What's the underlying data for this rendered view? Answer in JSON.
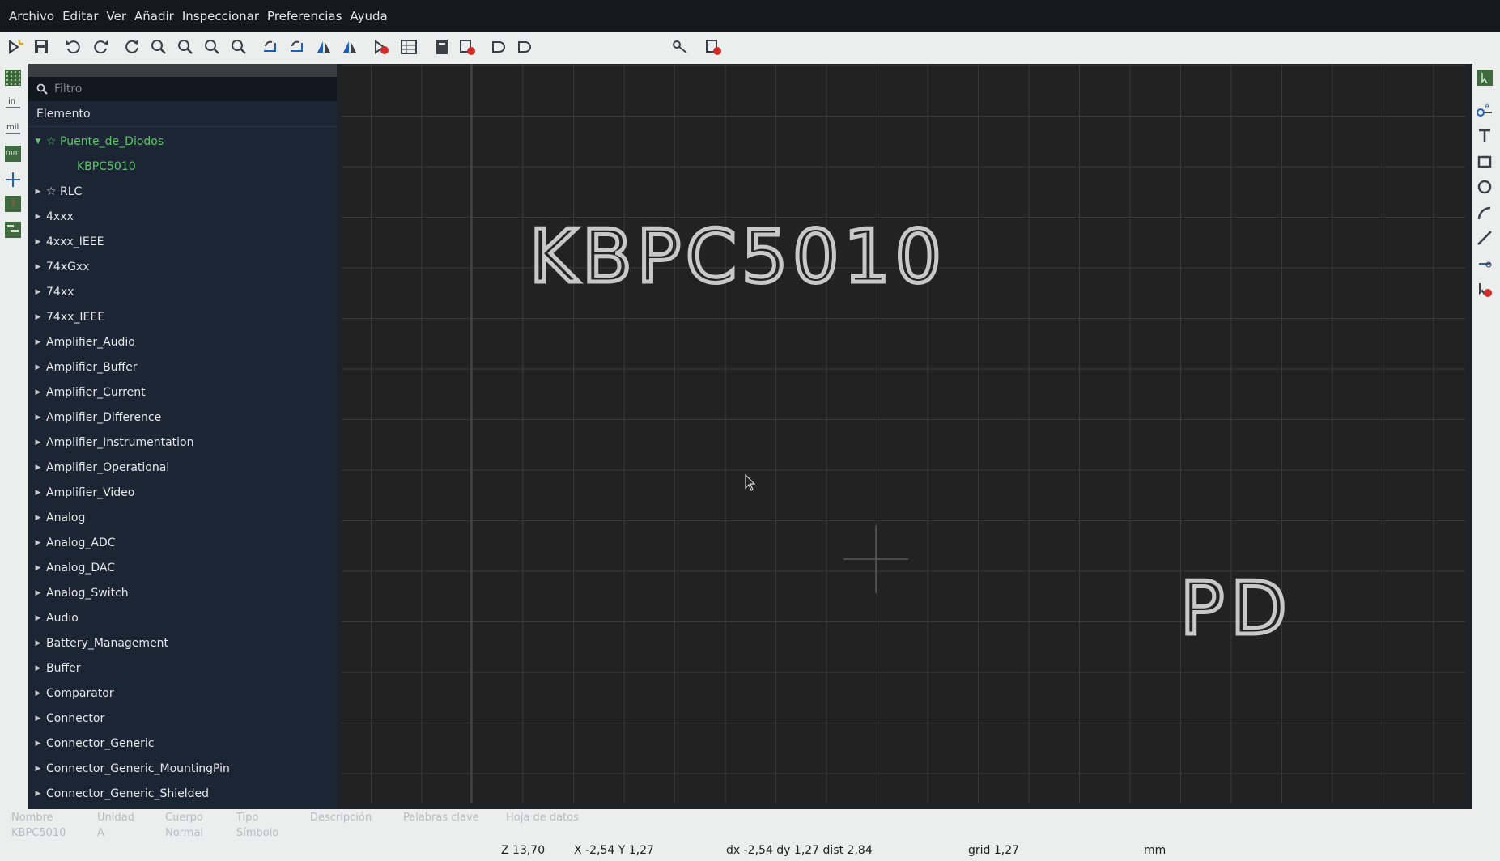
{
  "menu": [
    "Archivo",
    "Editar",
    "Ver",
    "Añadir",
    "Inspeccionar",
    "Preferencias",
    "Ayuda"
  ],
  "toolbar_icons": [
    "new-symbol-icon",
    "save-icon",
    "undo-icon",
    "redo-icon",
    "refresh-icon",
    "zoom-in-icon",
    "zoom-out-icon",
    "zoom-fit-icon",
    "zoom-selection-icon",
    "rotate-ccw-icon",
    "rotate-cw-icon",
    "mirror-vertical-icon",
    "mirror-horizontal-icon",
    "symbol-properties-icon",
    "pin-table-icon",
    "datasheet-icon",
    "check-symbol-icon",
    "show-deMorgan-standard-icon",
    "show-deMorgan-alternate-icon",
    "pin-connection-icon",
    "insert-symbol-icon"
  ],
  "left_toolbar_icons": [
    "grid-toggle-icon",
    "units-inches-icon",
    "units-mils-icon",
    "units-mm-icon",
    "cursor-fullscreen-icon",
    "pin-electrical-type-icon",
    "symbol-tree-toggle-icon"
  ],
  "right_toolbar_icons": [
    "select-icon",
    "add-pin-icon",
    "add-text-icon",
    "add-rectangle-icon",
    "add-circle-icon",
    "add-arc-icon",
    "add-line-icon",
    "anchor-icon",
    "delete-icon"
  ],
  "filter": {
    "placeholder": "Filtro"
  },
  "tree_header": "Elemento",
  "tree": [
    {
      "label": "☆ Puente_de_Diodos",
      "expanded": true,
      "kind": "lib-sel"
    },
    {
      "label": "KBPC5010",
      "kind": "sym"
    },
    {
      "label": "☆ RLC",
      "kind": "lib"
    },
    {
      "label": "4xxx",
      "kind": "lib"
    },
    {
      "label": "4xxx_IEEE",
      "kind": "lib"
    },
    {
      "label": "74xGxx",
      "kind": "lib"
    },
    {
      "label": "74xx",
      "kind": "lib"
    },
    {
      "label": "74xx_IEEE",
      "kind": "lib"
    },
    {
      "label": "Amplifier_Audio",
      "kind": "lib"
    },
    {
      "label": "Amplifier_Buffer",
      "kind": "lib"
    },
    {
      "label": "Amplifier_Current",
      "kind": "lib"
    },
    {
      "label": "Amplifier_Difference",
      "kind": "lib"
    },
    {
      "label": "Amplifier_Instrumentation",
      "kind": "lib"
    },
    {
      "label": "Amplifier_Operational",
      "kind": "lib"
    },
    {
      "label": "Amplifier_Video",
      "kind": "lib"
    },
    {
      "label": "Analog",
      "kind": "lib"
    },
    {
      "label": "Analog_ADC",
      "kind": "lib"
    },
    {
      "label": "Analog_DAC",
      "kind": "lib"
    },
    {
      "label": "Analog_Switch",
      "kind": "lib"
    },
    {
      "label": "Audio",
      "kind": "lib"
    },
    {
      "label": "Battery_Management",
      "kind": "lib"
    },
    {
      "label": "Buffer",
      "kind": "lib"
    },
    {
      "label": "Comparator",
      "kind": "lib"
    },
    {
      "label": "Connector",
      "kind": "lib"
    },
    {
      "label": "Connector_Generic",
      "kind": "lib"
    },
    {
      "label": "Connector_Generic_MountingPin",
      "kind": "lib"
    },
    {
      "label": "Connector_Generic_Shielded",
      "kind": "lib"
    }
  ],
  "canvas": {
    "value_text": "KBPC5010",
    "reference_text": "PD"
  },
  "info": {
    "nombre": {
      "h": "Nombre",
      "v": "KBPC5010"
    },
    "unidad": {
      "h": "Unidad",
      "v": "A"
    },
    "cuerpo": {
      "h": "Cuerpo",
      "v": "Normal"
    },
    "tipo": {
      "h": "Tipo",
      "v": "Símbolo"
    },
    "descripcion": {
      "h": "Descripción",
      "v": ""
    },
    "palabras": {
      "h": "Palabras clave",
      "v": ""
    },
    "hoja": {
      "h": "Hoja de datos",
      "v": ""
    }
  },
  "status": {
    "zoom": "Z 13,70",
    "xy": "X -2,54  Y 1,27",
    "delta": "dx -2,54  dy 1,27  dist 2,84",
    "grid": "grid 1,27",
    "units": "mm"
  },
  "colors": {
    "canvas_bg": "#222222",
    "grid": "#3a3a3a",
    "text": "#c8c8c8",
    "selected_green": "#5ec66a",
    "panel_bg": "#1c2533"
  }
}
